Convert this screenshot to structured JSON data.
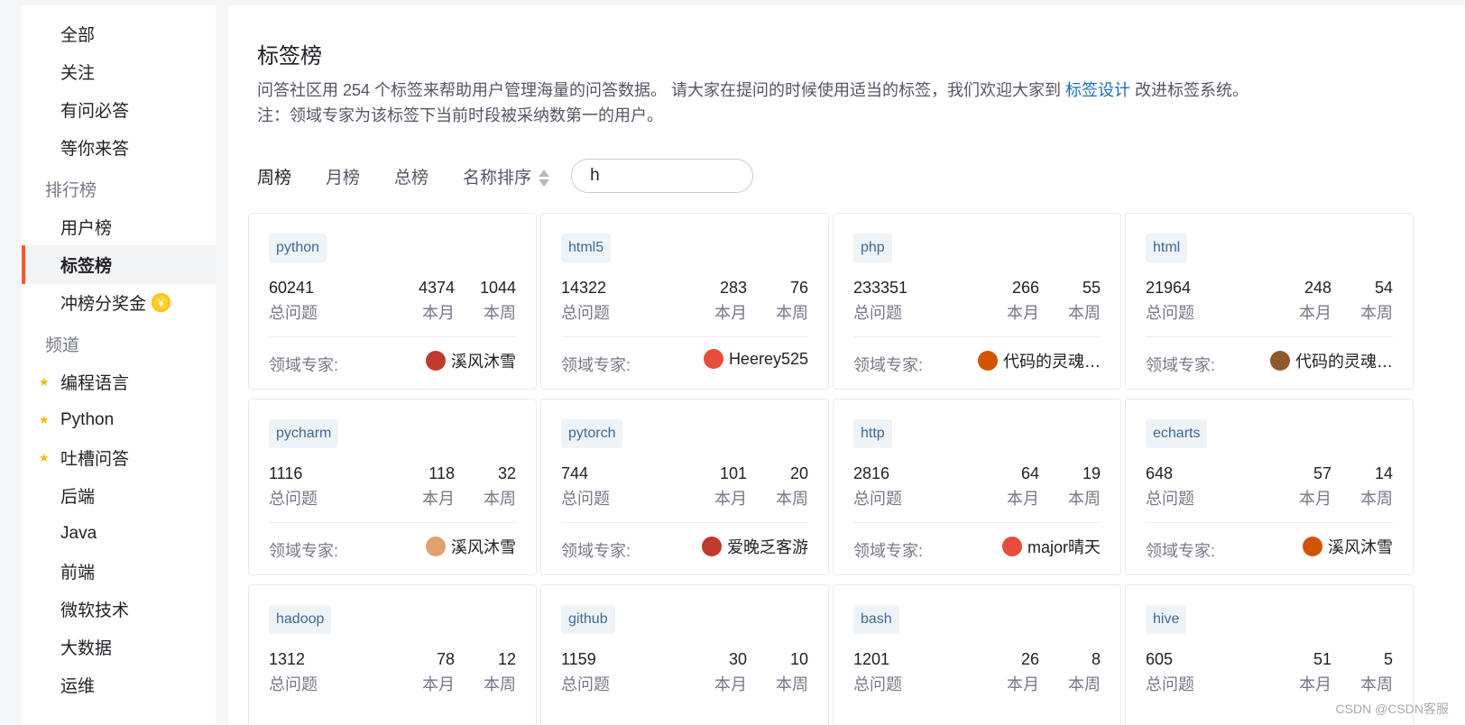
{
  "sidebar": {
    "items": [
      {
        "label": "全部"
      },
      {
        "label": "关注"
      },
      {
        "label": "有问必答"
      },
      {
        "label": "等你来答"
      }
    ],
    "ranking_group": "排行榜",
    "ranking_items": [
      {
        "label": "用户榜"
      },
      {
        "label": "标签榜"
      },
      {
        "label": "冲榜分奖金"
      }
    ],
    "channel_group": "频道",
    "channel_items": [
      {
        "label": "编程语言"
      },
      {
        "label": "Python"
      },
      {
        "label": "吐槽问答"
      },
      {
        "label": "后端"
      },
      {
        "label": "Java"
      },
      {
        "label": "前端"
      },
      {
        "label": "微软技术"
      },
      {
        "label": "大数据"
      },
      {
        "label": "运维"
      }
    ]
  },
  "header": {
    "title": "标签榜",
    "desc_before": "问答社区用 254 个标签来帮助用户管理海量的问答数据。 请大家在提问的时候使用适当的标签，我们欢迎大家到 ",
    "desc_link": "标签设计",
    "desc_after": " 改进标签系统。",
    "note": "注：领域专家为该标签下当前时段被采纳数第一的用户。"
  },
  "tabs": {
    "week": "周榜",
    "month": "月榜",
    "total": "总榜",
    "name_sort": "名称排序"
  },
  "search": {
    "value": "h"
  },
  "labels": {
    "total": "总问题",
    "month": "本月",
    "week": "本周",
    "expert": "领域专家:"
  },
  "cards": [
    {
      "tag": "python",
      "total": "60241",
      "month": "4374",
      "week": "1044",
      "expert": "溪风沐雪"
    },
    {
      "tag": "html5",
      "total": "14322",
      "month": "283",
      "week": "76",
      "expert": "Heerey525"
    },
    {
      "tag": "php",
      "total": "233351",
      "month": "266",
      "week": "55",
      "expert": "代码的灵魂…"
    },
    {
      "tag": "html",
      "total": "21964",
      "month": "248",
      "week": "54",
      "expert": "代码的灵魂…"
    },
    {
      "tag": "pycharm",
      "total": "1116",
      "month": "118",
      "week": "32",
      "expert": "溪风沐雪"
    },
    {
      "tag": "pytorch",
      "total": "744",
      "month": "101",
      "week": "20",
      "expert": "爱晚乏客游"
    },
    {
      "tag": "http",
      "total": "2816",
      "month": "64",
      "week": "19",
      "expert": "major晴天"
    },
    {
      "tag": "echarts",
      "total": "648",
      "month": "57",
      "week": "14",
      "expert": "溪风沐雪"
    },
    {
      "tag": "hadoop",
      "total": "1312",
      "month": "78",
      "week": "12",
      "expert": ""
    },
    {
      "tag": "github",
      "total": "1159",
      "month": "30",
      "week": "10",
      "expert": ""
    },
    {
      "tag": "bash",
      "total": "1201",
      "month": "26",
      "week": "8",
      "expert": ""
    },
    {
      "tag": "hive",
      "total": "605",
      "month": "51",
      "week": "5",
      "expert": ""
    }
  ],
  "watermark": "CSDN @CSDN客服"
}
